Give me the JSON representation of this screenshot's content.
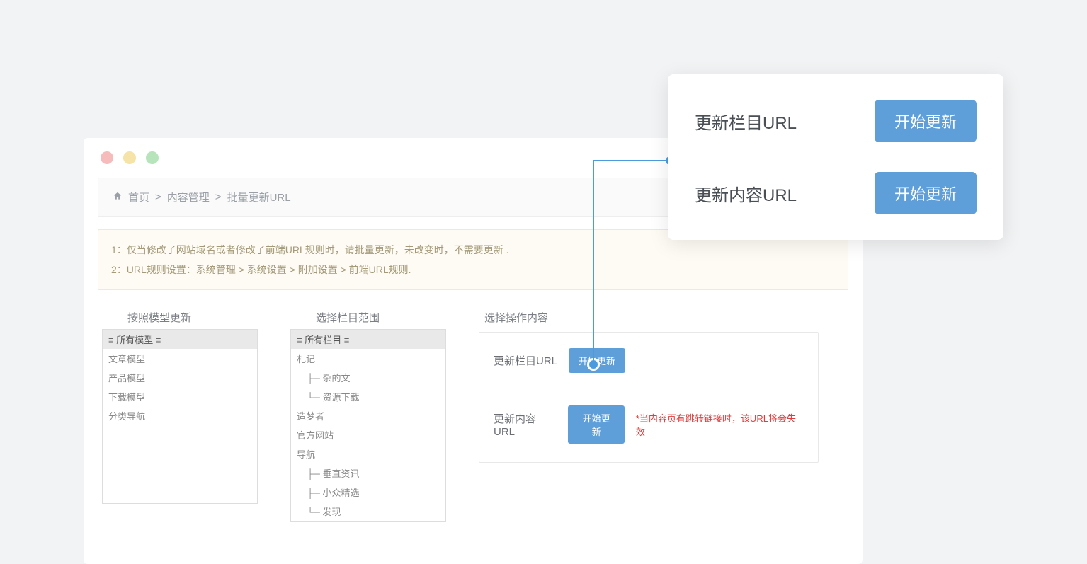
{
  "breadcrumb": {
    "home": "首页",
    "sep": ">",
    "item1": "内容管理",
    "item2": "批量更新URL"
  },
  "notice": {
    "line1": "1：仅当修改了网站域名或者修改了前端URL规则时，请批量更新，未改变时，不需要更新 .",
    "line2": "2：URL规则设置：系统管理 > 系统设置 > 附加设置 > 前端URL规则."
  },
  "columns": {
    "model_header": "按照模型更新",
    "model_options": [
      "≡ 所有模型 ≡",
      "文章模型",
      "产品模型",
      "下载模型",
      "分类导航"
    ],
    "scope_header": "选择栏目范围",
    "scope_options": [
      "≡ 所有栏目 ≡",
      "札记",
      "    ├─ 杂的文",
      "    └─ 资源下载",
      "造梦者",
      "官方网站",
      "导航",
      "    ├─ 垂直资讯",
      "    ├─ 小众精选",
      "    └─ 发现"
    ],
    "ops_header": "选择操作内容"
  },
  "ops": {
    "row1_label": "更新栏目URL",
    "row1_btn": "开始更新",
    "row2_label": "更新内容URL",
    "row2_btn": "开始更新",
    "row2_warn": "*当内容页有跳转链接时，该URL将会失效"
  },
  "callout": {
    "row1_label": "更新栏目URL",
    "row1_btn": "开始更新",
    "row2_label": "更新内容URL",
    "row2_btn": "开始更新"
  }
}
